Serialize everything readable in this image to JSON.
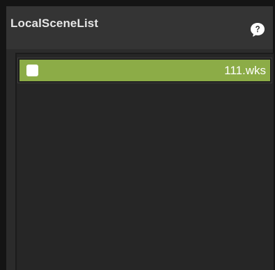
{
  "panel": {
    "title": "LocalSceneList",
    "help_icon": "help-bubble-icon"
  },
  "scene_list": {
    "items": [
      {
        "label": "111.wks",
        "checked": false
      }
    ]
  },
  "colors": {
    "background": "#2b2b2b",
    "header": "#343434",
    "item_selected": "#8cac47",
    "text": "#e6e6e6"
  }
}
